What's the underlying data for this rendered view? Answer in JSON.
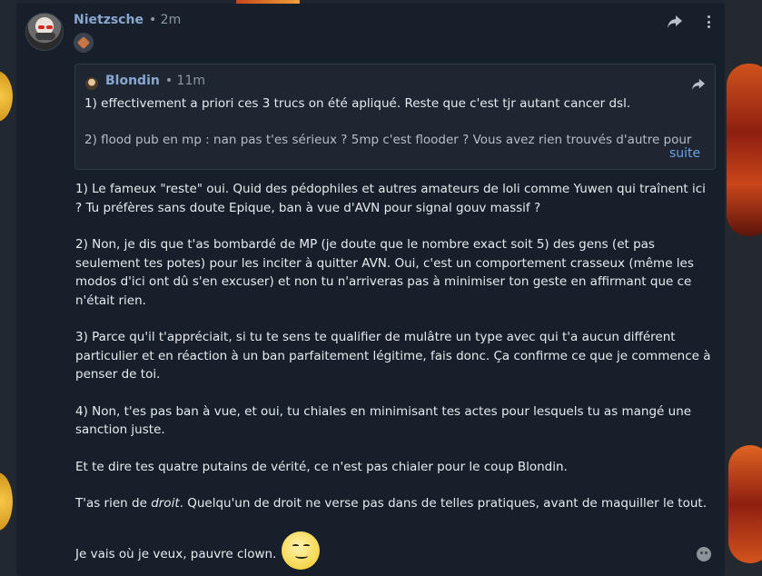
{
  "post": {
    "author": "Nietzsche",
    "time": "• 2m",
    "quote": {
      "author": "Blondin",
      "time": "• 11m",
      "paragraphs": [
        "1) effectivement a priori ces 3 trucs on été apliqué. Reste que c'est tjr autant cancer dsl.",
        "2) flood pub en mp : nan pas t'es sérieux ? 5mp c'est flooder ? Vous avez rien trouvés d'autre pour"
      ],
      "more_label": "suite"
    },
    "paragraphs": [
      "1) Le fameux \"reste\" oui. Quid des pédophiles et autres amateurs de loli comme Yuwen qui traînent ici ? Tu préfères sans doute Epique, ban à vue d'AVN pour signal gouv massif ?",
      "2) Non, je dis que t'as bombardé de MP (je doute que le nombre exact soit 5) des gens (et pas seulement tes potes) pour les inciter à quitter AVN. Oui, c'est un comportement crasseux (même les modos d'ici ont dû s'en excuser) et non tu n'arriveras pas à minimiser ton geste en affirmant que ce n'était rien.",
      "3) Parce qu'il t'appréciait, si tu te sens te qualifier de mulâtre un type avec qui t'a aucun différent particulier et en réaction à un ban parfaitement légitime, fais donc. Ça confirme ce que je commence à penser de toi.",
      "4) Non, t'es pas ban à vue, et oui, tu chiales en minimisant tes actes pour lesquels tu as mangé une sanction juste.",
      "Et te dire tes quatre putains de vérité, ce n'est pas chialer pour le coup Blondin."
    ],
    "right_prefix": "T'as rien de ",
    "right_em": "droit",
    "right_suffix": ". Quelqu'un de droit ne verse pas dans de telles pratiques, avant de maquiller le tout.",
    "last_line": "Je vais où je veux, pauvre clown."
  },
  "icons": {
    "share": "share-icon",
    "menu": "more-vertical-icon",
    "rank": "rank-badge-icon",
    "emoji": "smiley-emoji-icon",
    "react": "add-reaction-icon"
  },
  "colors": {
    "card_bg": "#17202a",
    "author": "#8aa6cf",
    "link": "#6ea0e3"
  }
}
